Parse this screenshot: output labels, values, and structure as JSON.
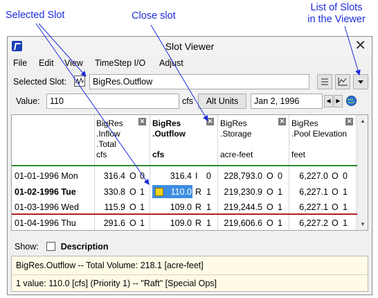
{
  "callouts": {
    "selected_slot": "Selected Slot",
    "close_slot": "Close slot",
    "list_of_slots": [
      "List of Slots",
      "in the Viewer"
    ]
  },
  "window": {
    "title": "Slot Viewer",
    "close_glyph": "✕"
  },
  "menu": [
    "File",
    "Edit",
    "View",
    "TimeStep I/O",
    "Adjust"
  ],
  "toolbar": {
    "selected_slot_label": "Selected Slot:",
    "selected_slot_value": "BigRes.Outflow",
    "value_label": "Value:",
    "value": "110",
    "units": "cfs",
    "alt_units_button": "Alt Units",
    "date": "Jan 2, 1996",
    "icons": [
      "slot-type-icon",
      "table-view-icon",
      "plot-view-icon",
      "slot-list-dropdown-icon",
      "date-prev-icon",
      "date-next-icon",
      "globe-icon"
    ]
  },
  "table": {
    "columns": [
      {
        "lines": [
          "BigRes",
          ".Inflow",
          ".Total",
          "cfs"
        ],
        "bold": false
      },
      {
        "lines": [
          "BigRes",
          ".Outflow",
          "",
          "cfs"
        ],
        "bold": true
      },
      {
        "lines": [
          "BigRes",
          ".Storage",
          "",
          "acre-feet"
        ],
        "bold": false
      },
      {
        "lines": [
          "BigRes",
          ".Pool Elevation",
          "",
          "feet"
        ],
        "bold": false
      }
    ],
    "close_glyph": "✕",
    "rows": [
      {
        "date": "01-01-1996 Mon",
        "bold": false,
        "cells": [
          [
            "316.4",
            "O",
            "0"
          ],
          [
            "316.4",
            "I",
            "0"
          ],
          [
            "228,793.0",
            "O",
            "0"
          ],
          [
            "6,227.0",
            "O",
            "0"
          ]
        ]
      },
      {
        "date": "01-02-1996 Tue",
        "bold": true,
        "cells": [
          [
            "330.8",
            "O",
            "1"
          ],
          [
            "110.0",
            "R",
            "1"
          ],
          [
            "219,230.9",
            "O",
            "1"
          ],
          [
            "6,227.1",
            "O",
            "1"
          ]
        ]
      },
      {
        "date": "01-03-1996 Wed",
        "bold": false,
        "cells": [
          [
            "115.9",
            "O",
            "1"
          ],
          [
            "109.0",
            "R",
            "1"
          ],
          [
            "219,244.5",
            "O",
            "1"
          ],
          [
            "6,227.1",
            "O",
            "1"
          ]
        ]
      },
      {
        "date": "01-04-1996 Thu",
        "bold": false,
        "cells": [
          [
            "291.6",
            "O",
            "1"
          ],
          [
            "109.0",
            "R",
            "1"
          ],
          [
            "219,606.6",
            "O",
            "1"
          ],
          [
            "6,227.2",
            "O",
            "1"
          ]
        ]
      }
    ],
    "selected_color": "#3d8ee0"
  },
  "show": {
    "label": "Show:",
    "description": "Description"
  },
  "info": {
    "line1": "BigRes.Outflow -- Total Volume: 218.1 [acre-feet]",
    "line2": "1 value:  110.0 [cfs]  (Priority 1) -- \"Raft\" [Special Ops]"
  },
  "colors": {
    "callout": "#1d2bd9",
    "green_line": "#2e8b2e",
    "red_line": "#b02020"
  }
}
